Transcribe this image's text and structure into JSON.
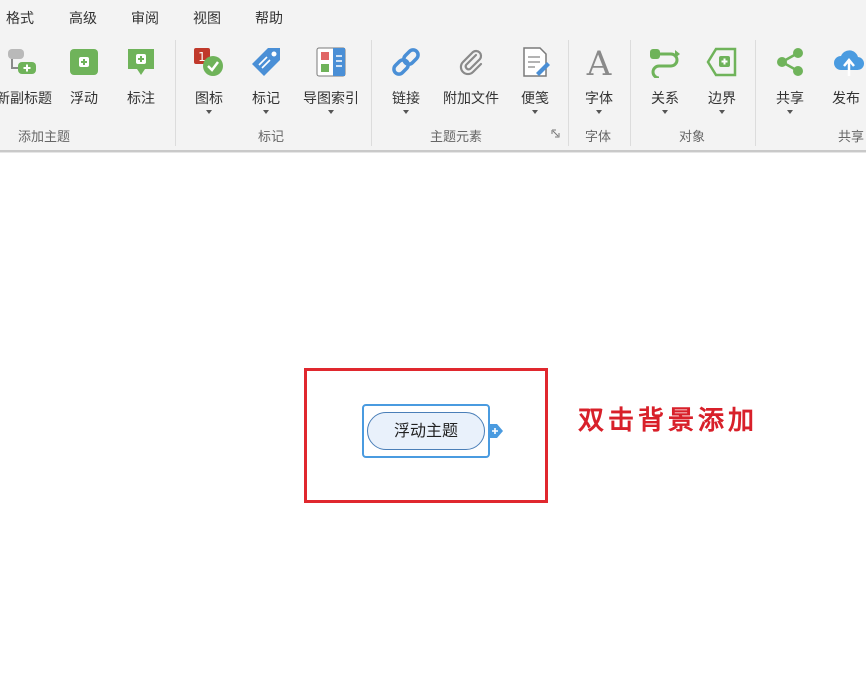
{
  "menu": [
    "格式",
    "高级",
    "审阅",
    "视图",
    "帮助"
  ],
  "ribbon": {
    "buttons": {
      "subtopic": "新副标题",
      "floating": "浮动",
      "callout": "标注",
      "icon": "图标",
      "marker": "标记",
      "map_index": "导图索引",
      "link": "链接",
      "attachment": "附加文件",
      "note": "便笺",
      "font": "字体",
      "relation": "关系",
      "boundary": "边界",
      "share": "共享",
      "publish": "发布"
    },
    "groups": {
      "add_topic": "添加主题",
      "marker": "标记",
      "topic_elements": "主题元素",
      "font": "字体",
      "objects": "对象",
      "share": "共享"
    }
  },
  "canvas": {
    "topic_label": "浮动主题",
    "annotation": "双击背景添加"
  },
  "colors": {
    "highlight_box": "#e0282e",
    "topic_border": "#4a9be0",
    "topic_fill": "#e9f1fb",
    "annotation_text": "#d8202a",
    "icon_green": "#6fb35a"
  }
}
